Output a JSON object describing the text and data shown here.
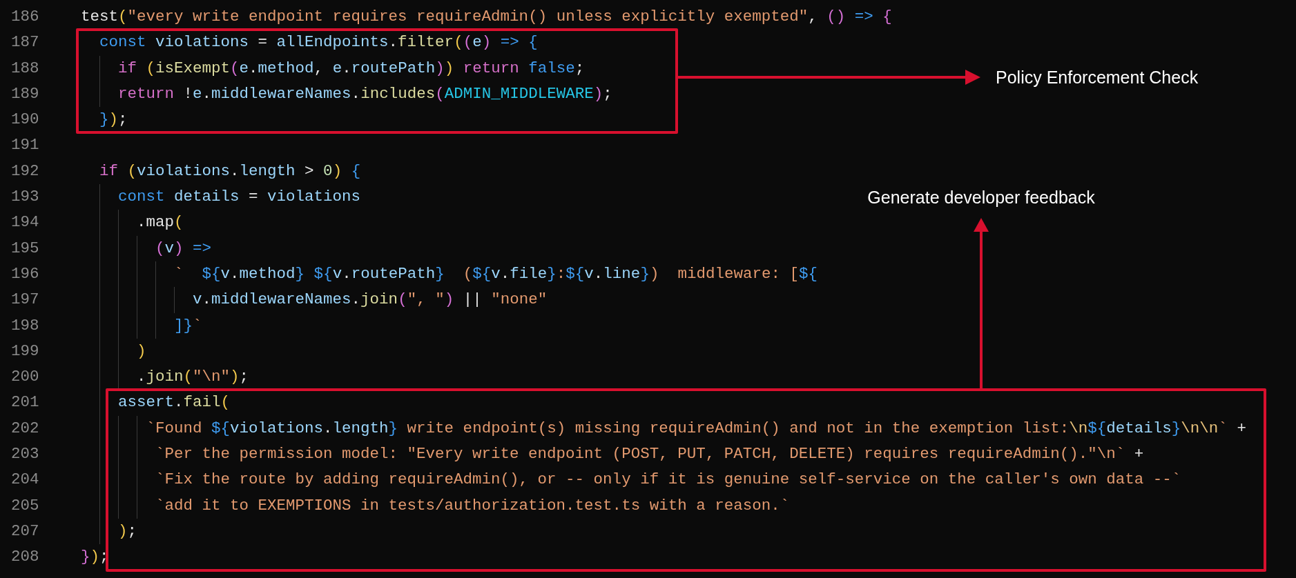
{
  "code_blocks": [
    {
      "kind": "plain",
      "lines": [
        {
          "number": "186",
          "tokens": [
            {
              "text": "test",
              "kind": "plain"
            },
            {
              "text": "(",
              "kind": "brace1"
            },
            {
              "text": "\"every write endpoint requires requireAdmin() unless explicitly exempted\"",
              "kind": "string"
            },
            {
              "text": ", ",
              "kind": "plain"
            },
            {
              "text": "()",
              "kind": "brace2"
            },
            {
              "text": " => ",
              "kind": "storage"
            },
            {
              "text": "{",
              "kind": "brace2"
            }
          ]
        }
      ]
    },
    {
      "kind": "boxed",
      "annotation": {
        "label": "Policy Enforcement Check",
        "kind": "right"
      },
      "lines": [
        {
          "number": "187",
          "tokens": [
            {
              "text": "  const",
              "kind": "storage"
            },
            {
              "text": " violations",
              "kind": "variable"
            },
            {
              "text": " = ",
              "kind": "plain"
            },
            {
              "text": "allEndpoints",
              "kind": "variable"
            },
            {
              "text": ".",
              "kind": "plain"
            },
            {
              "text": "filter",
              "kind": "func"
            },
            {
              "text": "(",
              "kind": "brace1"
            },
            {
              "text": "(",
              "kind": "brace2"
            },
            {
              "text": "e",
              "kind": "variable"
            },
            {
              "text": ")",
              "kind": "brace2"
            },
            {
              "text": " => ",
              "kind": "storage"
            },
            {
              "text": "{",
              "kind": "brace3"
            }
          ]
        },
        {
          "number": "188",
          "tokens": [
            {
              "text": "    if ",
              "kind": "control"
            },
            {
              "text": "(",
              "kind": "brace1"
            },
            {
              "text": "isExempt",
              "kind": "func"
            },
            {
              "text": "(",
              "kind": "brace2"
            },
            {
              "text": "e",
              "kind": "variable"
            },
            {
              "text": ".",
              "kind": "plain"
            },
            {
              "text": "method",
              "kind": "variable"
            },
            {
              "text": ", ",
              "kind": "plain"
            },
            {
              "text": "e",
              "kind": "variable"
            },
            {
              "text": ".",
              "kind": "plain"
            },
            {
              "text": "routePath",
              "kind": "variable"
            },
            {
              "text": ")",
              "kind": "brace2"
            },
            {
              "text": ")",
              "kind": "brace1"
            },
            {
              "text": " return",
              "kind": "control"
            },
            {
              "text": " false",
              "kind": "storage"
            },
            {
              "text": ";",
              "kind": "plain"
            }
          ]
        },
        {
          "number": "189",
          "tokens": [
            {
              "text": "    return",
              "kind": "control"
            },
            {
              "text": " !",
              "kind": "plain"
            },
            {
              "text": "e",
              "kind": "variable"
            },
            {
              "text": ".",
              "kind": "plain"
            },
            {
              "text": "middlewareNames",
              "kind": "variable"
            },
            {
              "text": ".",
              "kind": "plain"
            },
            {
              "text": "includes",
              "kind": "func"
            },
            {
              "text": "(",
              "kind": "brace2"
            },
            {
              "text": "ADMIN_MIDDLEWARE",
              "kind": "constant"
            },
            {
              "text": ")",
              "kind": "brace2"
            },
            {
              "text": ";",
              "kind": "plain"
            }
          ]
        },
        {
          "number": "190",
          "tokens": [
            {
              "text": "  }",
              "kind": "brace3"
            },
            {
              "text": ")",
              "kind": "brace1"
            },
            {
              "text": ";",
              "kind": "plain"
            }
          ]
        }
      ]
    },
    {
      "kind": "plain",
      "lines": [
        {
          "number": "191"
        },
        {
          "number": "192",
          "tokens": [
            {
              "text": "  if ",
              "kind": "control"
            },
            {
              "text": "(",
              "kind": "brace1"
            },
            {
              "text": "violations",
              "kind": "variable"
            },
            {
              "text": ".",
              "kind": "plain"
            },
            {
              "text": "length",
              "kind": "variable"
            },
            {
              "text": " > ",
              "kind": "plain"
            },
            {
              "text": "0",
              "kind": "number"
            },
            {
              "text": ")",
              "kind": "brace1"
            },
            {
              "text": " {",
              "kind": "brace3"
            }
          ]
        },
        {
          "number": "193",
          "tokens": [
            {
              "text": "    const",
              "kind": "storage"
            },
            {
              "text": " details",
              "kind": "variable"
            },
            {
              "text": " = ",
              "kind": "plain"
            },
            {
              "text": "violations",
              "kind": "variable"
            }
          ]
        },
        {
          "number": "194",
          "tokens": [
            {
              "text": "      .map",
              "kind": "plain"
            },
            {
              "text": "(",
              "kind": "brace1"
            }
          ]
        },
        {
          "number": "195",
          "tokens": [
            {
              "text": "        (",
              "kind": "brace2"
            },
            {
              "text": "v",
              "kind": "variable"
            },
            {
              "text": ")",
              "kind": "brace2"
            },
            {
              "text": " =>",
              "kind": "storage"
            }
          ]
        },
        {
          "number": "196",
          "tokens": [
            {
              "text": "          `  ",
              "kind": "string"
            },
            {
              "text": "${",
              "kind": "storage"
            },
            {
              "text": "v",
              "kind": "variable"
            },
            {
              "text": ".",
              "kind": "plain"
            },
            {
              "text": "method",
              "kind": "variable"
            },
            {
              "text": "} ",
              "kind": "storage"
            },
            {
              "text": "${",
              "kind": "storage"
            },
            {
              "text": "v",
              "kind": "variable"
            },
            {
              "text": ".",
              "kind": "plain"
            },
            {
              "text": "routePath",
              "kind": "variable"
            },
            {
              "text": "}",
              "kind": "storage"
            },
            {
              "text": "  (",
              "kind": "string"
            },
            {
              "text": "${",
              "kind": "storage"
            },
            {
              "text": "v",
              "kind": "variable"
            },
            {
              "text": ".",
              "kind": "plain"
            },
            {
              "text": "file",
              "kind": "variable"
            },
            {
              "text": "}",
              "kind": "storage"
            },
            {
              "text": ":",
              "kind": "string"
            },
            {
              "text": "${",
              "kind": "storage"
            },
            {
              "text": "v",
              "kind": "variable"
            },
            {
              "text": ".",
              "kind": "plain"
            },
            {
              "text": "line",
              "kind": "variable"
            },
            {
              "text": "}",
              "kind": "storage"
            },
            {
              "text": ")  middleware: [",
              "kind": "string"
            },
            {
              "text": "${",
              "kind": "storage"
            }
          ]
        },
        {
          "number": "197",
          "tokens": [
            {
              "text": "            v",
              "kind": "variable"
            },
            {
              "text": ".",
              "kind": "plain"
            },
            {
              "text": "middlewareNames",
              "kind": "variable"
            },
            {
              "text": ".",
              "kind": "plain"
            },
            {
              "text": "join",
              "kind": "func"
            },
            {
              "text": "(",
              "kind": "brace2"
            },
            {
              "text": "\", \"",
              "kind": "string"
            },
            {
              "text": ")",
              "kind": "brace2"
            },
            {
              "text": " || ",
              "kind": "plain"
            },
            {
              "text": "\"none\"",
              "kind": "string"
            }
          ]
        },
        {
          "number": "198",
          "tokens": [
            {
              "text": "          ]}",
              "kind": "storage"
            },
            {
              "text": "`",
              "kind": "string"
            }
          ]
        },
        {
          "number": "199",
          "tokens": [
            {
              "text": "      )",
              "kind": "brace1"
            }
          ]
        },
        {
          "number": "200",
          "tokens": [
            {
              "text": "      .",
              "kind": "plain"
            },
            {
              "text": "join",
              "kind": "func"
            },
            {
              "text": "(",
              "kind": "brace1"
            },
            {
              "text": "\"\\n\"",
              "kind": "string"
            },
            {
              "text": ")",
              "kind": "brace1"
            },
            {
              "text": ";",
              "kind": "plain"
            }
          ]
        }
      ]
    },
    {
      "kind": "boxed",
      "annotation": {
        "label": "Generate developer feedback",
        "kind": "up"
      },
      "lines": [
        {
          "number": "201",
          "tokens": [
            {
              "text": "    assert",
              "kind": "variable"
            },
            {
              "text": ".",
              "kind": "plain"
            },
            {
              "text": "fail",
              "kind": "func"
            },
            {
              "text": "(",
              "kind": "brace1"
            }
          ]
        },
        {
          "number": "202",
          "tokens": [
            {
              "text": "       `Found ",
              "kind": "string"
            },
            {
              "text": "${",
              "kind": "storage"
            },
            {
              "text": "violations",
              "kind": "variable"
            },
            {
              "text": ".",
              "kind": "plain"
            },
            {
              "text": "length",
              "kind": "variable"
            },
            {
              "text": "}",
              "kind": "storage"
            },
            {
              "text": " write endpoint(s) missing requireAdmin() and not in the exemption list:",
              "kind": "string"
            },
            {
              "text": "\\n",
              "kind": "escape"
            },
            {
              "text": "${",
              "kind": "storage"
            },
            {
              "text": "details",
              "kind": "variable"
            },
            {
              "text": "}",
              "kind": "storage"
            },
            {
              "text": "\\n\\n",
              "kind": "escape"
            },
            {
              "text": "`",
              "kind": "string"
            },
            {
              "text": " +",
              "kind": "plain"
            }
          ]
        },
        {
          "number": "203",
          "tokens": [
            {
              "text": "        `Per the permission model: \"Every write endpoint (POST, PUT, PATCH, DELETE) requires requireAdmin().\"\\n`",
              "kind": "string"
            },
            {
              "text": " +",
              "kind": "plain"
            }
          ]
        },
        {
          "number": "204",
          "tokens": [
            {
              "text": "        `Fix the route by adding requireAdmin(), or -- only if it is genuine self-service on the caller's own data --`",
              "kind": "string"
            }
          ]
        },
        {
          "number": "205",
          "tokens": [
            {
              "text": "        `add it to EXEMPTIONS in tests/authorization.test.ts with a reason.`",
              "kind": "string"
            }
          ]
        },
        {
          "number": "207",
          "tokens": [
            {
              "text": "    )",
              "kind": "brace1"
            },
            {
              "text": ";",
              "kind": "plain"
            }
          ]
        },
        {
          "number": "208",
          "tokens": [
            {
              "text": "}",
              "kind": "brace2"
            },
            {
              "text": ")",
              "kind": "brace1"
            },
            {
              "text": ";",
              "kind": "plain"
            }
          ]
        }
      ]
    }
  ]
}
